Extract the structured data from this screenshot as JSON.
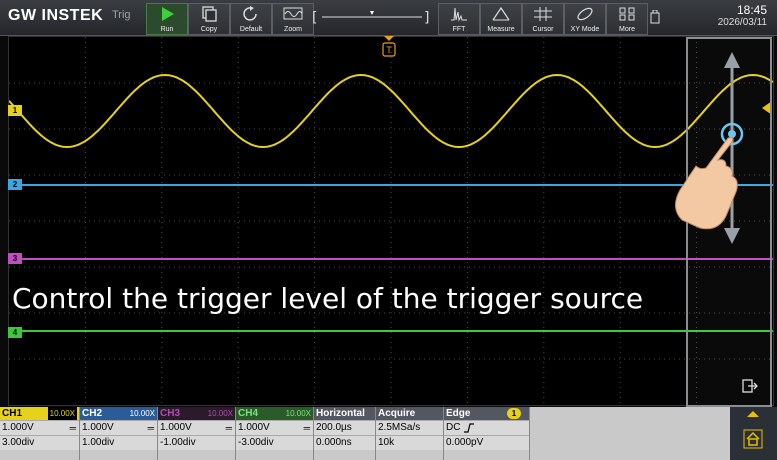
{
  "toolbar": {
    "brand": "GW INSTEK",
    "mode": "Trig",
    "run_label": "Run",
    "copy_label": "Copy",
    "default_label": "Default",
    "zoom_label": "Zoom",
    "fft_label": "FFT",
    "measure_label": "Measure",
    "cursor_label": "Cursor",
    "xymode_label": "XY Mode",
    "more_label": "More",
    "time": "18:45",
    "date": "2026/03/11"
  },
  "screen": {
    "trigger_marker": "T",
    "overlay_text": "Control the trigger level of the trigger source",
    "trace_labels": [
      "1",
      "2",
      "3",
      "4"
    ]
  },
  "channels": [
    {
      "name": "CH1",
      "probe": "10.00X",
      "volts": "1.000V",
      "coupling": "═",
      "offset": "3.00div"
    },
    {
      "name": "CH2",
      "probe": "10.00X",
      "volts": "1.000V",
      "coupling": "═",
      "offset": "1.00div"
    },
    {
      "name": "CH3",
      "probe": "10.00X",
      "volts": "1.000V",
      "coupling": "═",
      "offset": "-1.00div"
    },
    {
      "name": "CH4",
      "probe": "10.00X",
      "volts": "1.000V",
      "coupling": "═",
      "offset": "-3.00div"
    }
  ],
  "horizontal": {
    "title": "Horizontal",
    "timebase": "200.0µs",
    "position": "0.000ns"
  },
  "acquire": {
    "title": "Acquire",
    "rate": "2.5MSa/s",
    "length": "10k"
  },
  "trigger": {
    "title": "Edge",
    "source_badge": "1",
    "coupling": "DC",
    "level": "0.000pV"
  },
  "colors": {
    "ch1": "#e6d21a",
    "ch2": "#3aa8e0",
    "ch3": "#c04ec0",
    "ch4": "#3cc83c"
  }
}
